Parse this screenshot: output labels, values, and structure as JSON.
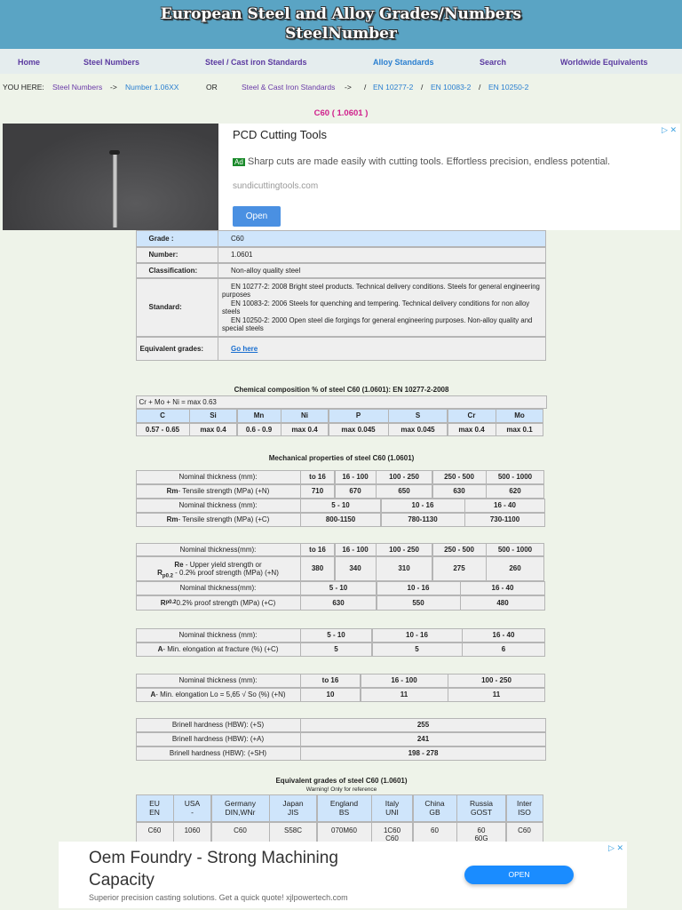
{
  "header": {
    "title_line1": "European Steel and Alloy Grades/Numbers",
    "title_line2": "SteelNumber"
  },
  "nav": [
    "Home",
    "Steel Numbers",
    "Steel / Cast iron Standards",
    "Alloy Standards",
    "Search",
    "Worldwide Equivalents"
  ],
  "breadcrumb": {
    "label": "YOU HERE:",
    "steel_numbers": "Steel Numbers",
    "arrow1": "->",
    "number": "Number 1.06XX",
    "or": "OR",
    "standards": "Steel & Cast Iron Standards",
    "arrow2": "->",
    "sep": "/",
    "en1": "EN 10277-2",
    "en2": "EN 10083-2",
    "en3": "EN 10250-2"
  },
  "page_title": "C60   ( 1.0601 )",
  "ad1": {
    "title": "PCD Cutting Tools",
    "badge": "Ad",
    "text": "Sharp cuts are made easily with cutting tools. Effortless precision, endless potential.",
    "domain": "sundicuttingtools.com",
    "button": "Open",
    "close": "▷ ✕"
  },
  "info": {
    "grade_label": "Grade :",
    "grade": "C60",
    "number_label": "Number:",
    "number": "1.0601",
    "class_label": "Classification:",
    "class": "Non-alloy quality steel",
    "standard_label": "Standard:",
    "standards": [
      "EN 10277-2: 2008 Bright steel products. Technical delivery conditions. Steels for general engineering purposes",
      "EN 10083-2: 2006 Steels for quenching and tempering. Technical delivery conditions for non alloy steels",
      "EN 10250-2: 2000 Open steel die forgings for general engineering purposes. Non-alloy quality and special steels"
    ],
    "equiv_label": "Equivalent grades:",
    "equiv_link": "Go here"
  },
  "chem": {
    "title": "Chemical composition %   of   steel   C60 (1.0601):   EN 10277-2-2008",
    "note": "Cr + Mo + Ni = max 0.63",
    "headers": [
      "C",
      "Si",
      "Mn",
      "Ni",
      "P",
      "S",
      "Cr",
      "Mo"
    ],
    "values": [
      "0.57 - 0.65",
      "max   0.4",
      "0.6 - 0.9",
      "max   0.4",
      "max   0.045",
      "max   0.045",
      "max   0.4",
      "max   0.1"
    ]
  },
  "mech": {
    "title": "Mechanical properties of   steel   C60 (1.0601)",
    "t1": {
      "thk_label": "Nominal thickness (mm):",
      "thk": [
        "to 16",
        "16 - 100",
        "100 - 250",
        "250 - 500",
        "500 - 1000"
      ],
      "rm_b": "Rm",
      "rm_n": " - Tensile strength (MPa) (+N)",
      "rm": [
        "710",
        "670",
        "650",
        "630",
        "620"
      ],
      "thk2": [
        "5 - 10",
        "10 - 16",
        "16 - 40"
      ],
      "rm_c": " - Tensile strength (MPa) (+C)",
      "rmc": [
        "800-1150",
        "780-1130",
        "730-1100"
      ]
    },
    "t2": {
      "thk_label": "Nominal thickness(mm):",
      "thk": [
        "to 16",
        "16 - 100",
        "100 - 250",
        "250 - 500",
        "500 - 1000"
      ],
      "re_b": "Re",
      "re_t": " - Upper yield strength or",
      "rp_b": "R",
      "rp_sub": "p0.2",
      "rp_t": " - 0.2% proof strength (MPa) (+N)",
      "re": [
        "380",
        "340",
        "310",
        "275",
        "260"
      ],
      "thk2": [
        "5 - 10",
        "10 - 16",
        "16 - 40"
      ],
      "rpc_t": " 0.2% proof strength (MPa) (+C)",
      "rpc": [
        "630",
        "550",
        "480"
      ]
    },
    "t3": {
      "thk_label": "Nominal thickness (mm):",
      "thk": [
        "5 - 10",
        "10 - 16",
        "16 - 40"
      ],
      "a_b": "A",
      "a_t": " - Min. elongation at fracture (%) (+C)",
      "a": [
        "5",
        "5",
        "6"
      ]
    },
    "t4": {
      "thk_label": "Nominal thickness (mm):",
      "thk": [
        "to 16",
        "16 - 100",
        "100 - 250"
      ],
      "a_b": "A",
      "a_t": " - Min. elongation Lo = 5,65 √ So (%) (+N)",
      "a": [
        "10",
        "11",
        "11"
      ]
    },
    "brinell": [
      {
        "label": "Brinell hardness   (HBW):   (+S)",
        "value": "255"
      },
      {
        "label": "Brinell hardness   (HBW):   (+A)",
        "value": "241"
      },
      {
        "label": "Brinell hardness   (HBW):   (+SH)",
        "value": "198 - 278"
      }
    ]
  },
  "equiv": {
    "title": "Equivalent grades of   steel   C60 (1.0601)",
    "warning": "Warning! Only for reference",
    "headers": [
      [
        "EU",
        "EN"
      ],
      [
        "USA",
        "-"
      ],
      [
        "Germany",
        "DIN,WNr"
      ],
      [
        "Japan",
        "JIS"
      ],
      [
        "England",
        "BS"
      ],
      [
        "Italy",
        "UNI"
      ],
      [
        "China",
        "GB"
      ],
      [
        "Russia",
        "GOST"
      ],
      [
        "Inter",
        "ISO"
      ]
    ],
    "values": [
      "C60",
      "1060",
      "C60",
      "S58C",
      "070M60",
      "1C60\nC60",
      "60",
      "60\n60G",
      "C60"
    ]
  },
  "ad2": {
    "title": "Oem Foundry - Strong Machining Capacity",
    "text": "Superior precision casting solutions. Get a quick quote! xjlpowertech.com",
    "button": "OPEN",
    "close": "▷ ✕"
  }
}
